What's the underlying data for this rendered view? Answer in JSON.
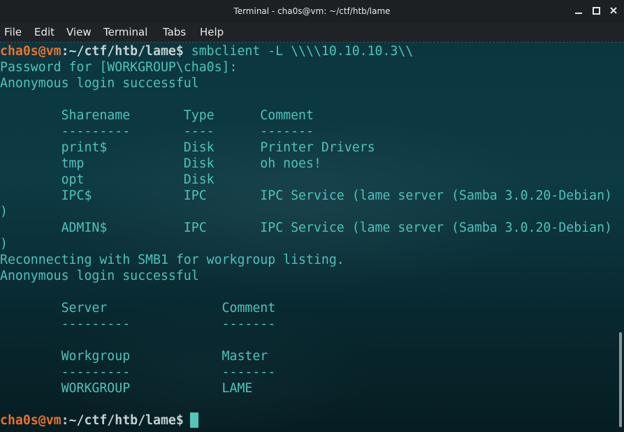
{
  "window": {
    "title": "Terminal - cha0s@vm: ~/ctf/htb/lame",
    "min_glyph": "–",
    "max_glyph": "□",
    "close_glyph": "✕"
  },
  "menu": [
    "File",
    "Edit",
    "View",
    "Terminal",
    "Tabs",
    "Help"
  ],
  "prompt": {
    "user": "cha0s@vm",
    "sep": ":",
    "path": "~/ctf/htb/lame$"
  },
  "terminal": {
    "command": " smbclient -L \\\\\\\\10.10.10.3\\\\",
    "lines": [
      "Password for [WORKGROUP\\cha0s]:",
      "Anonymous login successful",
      "",
      "        Sharename       Type      Comment",
      "        ---------       ----      -------",
      "        print$          Disk      Printer Drivers",
      "        tmp             Disk      oh noes!",
      "        opt             Disk      ",
      "        IPC$            IPC       IPC Service (lame server (Samba 3.0.20-Debian)",
      ")",
      "        ADMIN$          IPC       IPC Service (lame server (Samba 3.0.20-Debian)",
      ")",
      "Reconnecting with SMB1 for workgroup listing.",
      "Anonymous login successful",
      "",
      "        Server               Comment",
      "        ---------            -------",
      "",
      "        Workgroup            Master",
      "        ---------            -------",
      "        WORKGROUP            LAME",
      ""
    ],
    "final_command": " "
  },
  "colors": {
    "prompt_user": "#e9722f",
    "text": "#4fc3b9",
    "cursor": "#53c6ba"
  }
}
